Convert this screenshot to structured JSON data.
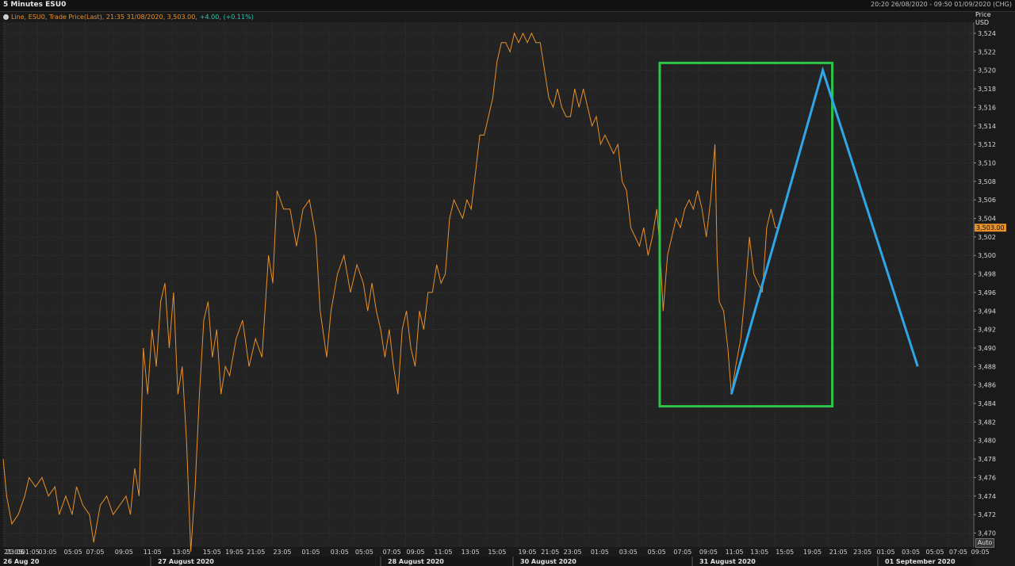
{
  "header": {
    "title": "5 Minutes ESU0",
    "range": "20:20 26/08/2020 - 09:50 01/09/2020 (CHG)"
  },
  "legend": {
    "text": "Line, ESU0, Trade Price(Last),  21:35 31/08/2020, 3,503.00, ",
    "change": "+4.00, (+0.11%)"
  },
  "axis": {
    "price_label": "Price",
    "currency_label": "USD",
    "auto_label": "Auto"
  },
  "chart_data": {
    "type": "line",
    "series_color": "#e8902a",
    "last_price_label": "3,503.00",
    "last_price_value": 3503,
    "ylim": [
      3468.5,
      3525.2
    ],
    "grid": true,
    "y_ticks": [
      3470,
      3472,
      3474,
      3476,
      3478,
      3480,
      3482,
      3484,
      3486,
      3488,
      3490,
      3492,
      3494,
      3496,
      3498,
      3500,
      3502,
      3504,
      3506,
      3508,
      3510,
      3512,
      3514,
      3516,
      3518,
      3520,
      3522,
      3524
    ],
    "y_tick_labels": [
      "3,470",
      "3,472",
      "3,474",
      "3,476",
      "3,478",
      "3,480",
      "3,482",
      "3,484",
      "3,486",
      "3,488",
      "3,490",
      "3,492",
      "3,494",
      "3,496",
      "3,498",
      "3,500",
      "3,502",
      "3,504",
      "3,506",
      "3,508",
      "3,510",
      "3,512",
      "3,514",
      "3,516",
      "3,518",
      "3,520",
      "3,522",
      "3,524"
    ],
    "time_labels": [
      "21:05",
      "23:05",
      "01:05",
      "03:05",
      "05:05",
      "07:05",
      "09:05",
      "11:05",
      "13:05",
      "15:05",
      "19:05",
      "21:05",
      "23:05",
      "01:05",
      "03:05",
      "05:05",
      "07:05",
      "09:05",
      "11:05",
      "13:05",
      "15:05",
      "19:05",
      "21:05",
      "23:05",
      "01:05",
      "03:05",
      "05:05",
      "07:05",
      "09:05",
      "11:05",
      "13:05",
      "15:05",
      "19:05",
      "21:05",
      "23:05",
      "01:05",
      "03:05",
      "05:05",
      "07:05",
      "09:05"
    ],
    "date_labels": [
      "26 Aug 20",
      "27 August 2020",
      "28 August 2020",
      "30 August 2020",
      "31 August 2020",
      "01 September 2020"
    ],
    "x_session_index": [
      0,
      5,
      40,
      80,
      139,
      190,
      257,
      323,
      390,
      461,
      513,
      563,
      624,
      690,
      757,
      814,
      878,
      933,
      997,
      1060,
      1122,
      1192,
      1245,
      1297,
      1360,
      1426,
      1492,
      1552,
      1612,
      1672,
      1730,
      1789,
      1853,
      1913,
      1969,
      2023,
      2081,
      2137,
      2191,
      2242
    ],
    "x_max": 2250,
    "series": [
      {
        "points": [
          [
            0,
            3478
          ],
          [
            8,
            3474
          ],
          [
            20,
            3471
          ],
          [
            35,
            3472
          ],
          [
            50,
            3474
          ],
          [
            60,
            3476
          ],
          [
            75,
            3475
          ],
          [
            90,
            3476
          ],
          [
            105,
            3474
          ],
          [
            120,
            3475
          ],
          [
            130,
            3472
          ],
          [
            145,
            3474
          ],
          [
            160,
            3472
          ],
          [
            170,
            3475
          ],
          [
            185,
            3473
          ],
          [
            200,
            3472
          ],
          [
            210,
            3469
          ],
          [
            225,
            3473
          ],
          [
            240,
            3474
          ],
          [
            255,
            3472
          ],
          [
            270,
            3473
          ],
          [
            285,
            3474
          ],
          [
            295,
            3472
          ],
          [
            305,
            3477
          ],
          [
            315,
            3474
          ],
          [
            325,
            3490
          ],
          [
            335,
            3485
          ],
          [
            345,
            3492
          ],
          [
            355,
            3488
          ],
          [
            365,
            3495
          ],
          [
            375,
            3497
          ],
          [
            385,
            3490
          ],
          [
            395,
            3496
          ],
          [
            405,
            3485
          ],
          [
            415,
            3488
          ],
          [
            425,
            3480
          ],
          [
            435,
            3468
          ],
          [
            445,
            3475
          ],
          [
            455,
            3485
          ],
          [
            465,
            3493
          ],
          [
            475,
            3495
          ],
          [
            485,
            3489
          ],
          [
            495,
            3492
          ],
          [
            505,
            3485
          ],
          [
            515,
            3488
          ],
          [
            525,
            3487
          ],
          [
            540,
            3491
          ],
          [
            555,
            3493
          ],
          [
            570,
            3488
          ],
          [
            585,
            3491
          ],
          [
            600,
            3489
          ],
          [
            615,
            3500
          ],
          [
            625,
            3497
          ],
          [
            635,
            3507
          ],
          [
            650,
            3505
          ],
          [
            665,
            3505
          ],
          [
            680,
            3501
          ],
          [
            695,
            3505
          ],
          [
            710,
            3506
          ],
          [
            725,
            3502
          ],
          [
            735,
            3494
          ],
          [
            750,
            3489
          ],
          [
            760,
            3494
          ],
          [
            775,
            3498
          ],
          [
            790,
            3500
          ],
          [
            805,
            3496
          ],
          [
            820,
            3499
          ],
          [
            835,
            3497
          ],
          [
            845,
            3494
          ],
          [
            855,
            3497
          ],
          [
            865,
            3494
          ],
          [
            875,
            3492
          ],
          [
            885,
            3489
          ],
          [
            895,
            3492
          ],
          [
            905,
            3488
          ],
          [
            915,
            3485
          ],
          [
            925,
            3492
          ],
          [
            935,
            3494
          ],
          [
            945,
            3490
          ],
          [
            955,
            3488
          ],
          [
            965,
            3494
          ],
          [
            975,
            3492
          ],
          [
            985,
            3496
          ],
          [
            995,
            3496
          ],
          [
            1005,
            3499
          ],
          [
            1015,
            3497
          ],
          [
            1025,
            3498
          ],
          [
            1035,
            3504
          ],
          [
            1045,
            3506
          ],
          [
            1055,
            3505
          ],
          [
            1065,
            3504
          ],
          [
            1075,
            3506
          ],
          [
            1085,
            3505
          ],
          [
            1095,
            3509
          ],
          [
            1105,
            3513
          ],
          [
            1115,
            3513
          ],
          [
            1125,
            3515
          ],
          [
            1135,
            3517
          ],
          [
            1145,
            3521
          ],
          [
            1155,
            3523
          ],
          [
            1165,
            3523
          ],
          [
            1175,
            3522
          ],
          [
            1185,
            3524
          ],
          [
            1195,
            3523
          ],
          [
            1205,
            3524
          ],
          [
            1215,
            3523
          ],
          [
            1225,
            3524
          ],
          [
            1235,
            3523
          ],
          [
            1245,
            3523
          ],
          [
            1255,
            3520
          ],
          [
            1265,
            3517
          ],
          [
            1275,
            3516
          ],
          [
            1285,
            3518
          ],
          [
            1295,
            3516
          ],
          [
            1305,
            3515
          ],
          [
            1315,
            3515
          ],
          [
            1325,
            3518
          ],
          [
            1335,
            3516
          ],
          [
            1345,
            3518
          ],
          [
            1355,
            3516
          ],
          [
            1365,
            3514
          ],
          [
            1375,
            3515
          ],
          [
            1385,
            3512
          ],
          [
            1395,
            3513
          ],
          [
            1405,
            3512
          ],
          [
            1415,
            3511
          ],
          [
            1425,
            3512
          ],
          [
            1435,
            3508
          ],
          [
            1445,
            3507
          ],
          [
            1455,
            3503
          ],
          [
            1465,
            3502
          ],
          [
            1475,
            3501
          ],
          [
            1485,
            3503
          ],
          [
            1495,
            3500
          ],
          [
            1505,
            3502
          ],
          [
            1515,
            3505
          ],
          [
            1522,
            3501
          ],
          [
            1530,
            3494
          ],
          [
            1540,
            3500
          ],
          [
            1550,
            3502
          ],
          [
            1560,
            3504
          ],
          [
            1570,
            3503
          ],
          [
            1580,
            3505
          ],
          [
            1590,
            3506
          ],
          [
            1600,
            3505
          ],
          [
            1610,
            3507
          ],
          [
            1620,
            3505
          ],
          [
            1630,
            3502
          ],
          [
            1640,
            3506
          ],
          [
            1650,
            3512
          ],
          [
            1655,
            3500
          ],
          [
            1660,
            3495
          ],
          [
            1670,
            3494
          ],
          [
            1680,
            3490
          ],
          [
            1688,
            3485
          ],
          [
            1698,
            3488
          ],
          [
            1710,
            3491
          ],
          [
            1720,
            3496
          ],
          [
            1730,
            3502
          ],
          [
            1740,
            3498
          ],
          [
            1750,
            3497
          ],
          [
            1760,
            3496
          ],
          [
            1770,
            3503
          ],
          [
            1780,
            3505
          ],
          [
            1790,
            3503
          ],
          [
            1795,
            3503
          ]
        ]
      }
    ],
    "annotations": {
      "green_box": {
        "x0": 1522,
        "x1": 1922,
        "y0": 3483.7,
        "y1": 3520.8,
        "color": "#2ec44a"
      },
      "blue_path": {
        "points": [
          [
            1688,
            3485
          ],
          [
            1900,
            3520
          ],
          [
            2120,
            3488
          ]
        ],
        "color": "#2ea6e8"
      }
    }
  }
}
